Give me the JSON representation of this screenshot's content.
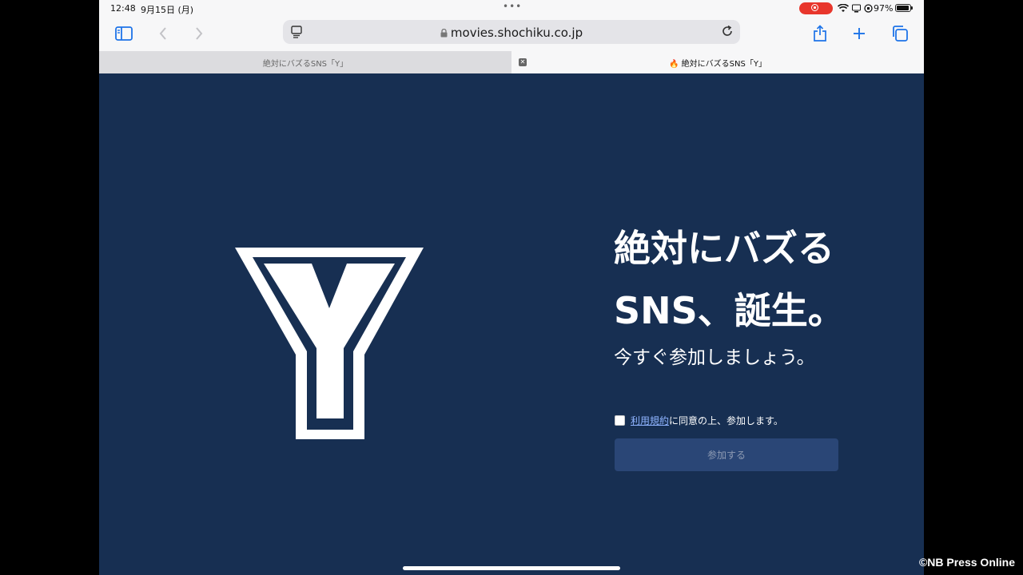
{
  "status": {
    "time": "12:48",
    "date": "9月15日 (月)",
    "battery_pct": "97%"
  },
  "browser": {
    "url": "movies.shochiku.co.jp",
    "tabs": [
      {
        "label": "絶対にバズるSNS「Y」",
        "active": false
      },
      {
        "label": "🔥 絶対にバズるSNS「Y」",
        "active": true
      }
    ]
  },
  "page": {
    "logo_letter": "Y",
    "headline_line1": "絶対にバズる",
    "headline_line2": "SNS、誕生。",
    "subline": "今すぐ参加しましょう。",
    "terms_link": "利用規約",
    "terms_rest": "に同意の上、参加します。",
    "join_label": "参加する"
  },
  "watermark": "©NB Press Online",
  "colors": {
    "background": "#172f52",
    "button": "#2a4676",
    "accent_link": "#8fb4ff",
    "record": "#e8362c"
  }
}
